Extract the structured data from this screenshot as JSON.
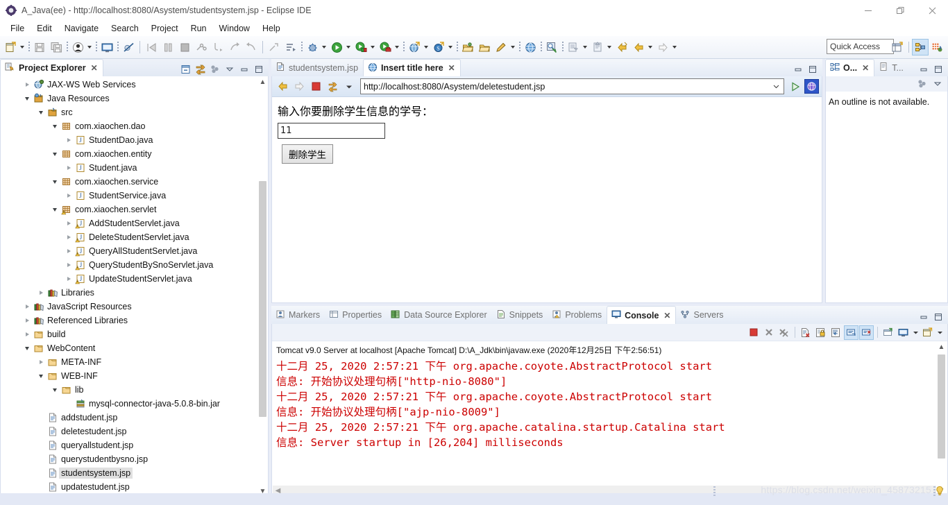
{
  "window": {
    "title": "A_Java(ee) - http://localhost:8080/Asystem/studentsystem.jsp - Eclipse IDE",
    "app_icon": "eclipse-icon",
    "minimize": "minimize-icon",
    "maximize": "restore-icon",
    "close": "close-icon"
  },
  "menubar": {
    "items": [
      {
        "label": "File"
      },
      {
        "label": "Edit"
      },
      {
        "label": "Navigate"
      },
      {
        "label": "Search"
      },
      {
        "label": "Project"
      },
      {
        "label": "Run"
      },
      {
        "label": "Window"
      },
      {
        "label": "Help"
      }
    ]
  },
  "toolbar": {
    "quick_access_placeholder": "Quick Access",
    "items": [
      {
        "icon": "new-wizard-icon",
        "dropdown": true
      },
      {
        "sep": "dots"
      },
      {
        "icon": "save-icon",
        "dropdown": false
      },
      {
        "icon": "save-all-icon",
        "dropdown": false
      },
      {
        "sep": "dots"
      },
      {
        "icon": "user-icon",
        "dropdown": true
      },
      {
        "sep": "dots"
      },
      {
        "icon": "open-console-icon",
        "dropdown": false
      },
      {
        "sep": "dots"
      },
      {
        "icon": "skip-breakpoints-icon",
        "dropdown": false
      },
      {
        "sep": "line"
      },
      {
        "icon": "resume-icon",
        "dropdown": false
      },
      {
        "icon": "suspend-icon",
        "dropdown": false
      },
      {
        "icon": "terminate-icon",
        "dropdown": false
      },
      {
        "icon": "disconnect-icon",
        "dropdown": false
      },
      {
        "icon": "step-into-icon",
        "dropdown": false
      },
      {
        "icon": "step-over-icon",
        "dropdown": false
      },
      {
        "icon": "step-return-icon",
        "dropdown": false
      },
      {
        "sep": "line"
      },
      {
        "icon": "next-annotation-icon",
        "dropdown": false
      },
      {
        "icon": "previous-annotation-icon",
        "dropdown": false
      },
      {
        "sep": "dots"
      },
      {
        "icon": "debug-icon",
        "dropdown": true
      },
      {
        "icon": "run-icon",
        "dropdown": true
      },
      {
        "icon": "run-as-server-icon",
        "dropdown": true
      },
      {
        "icon": "profile-icon",
        "dropdown": true
      },
      {
        "sep": "dots"
      },
      {
        "icon": "new-web-project-icon",
        "dropdown": true
      },
      {
        "icon": "new-server-icon",
        "dropdown": true
      },
      {
        "sep": "dots"
      },
      {
        "icon": "open-type-icon",
        "dropdown": false
      },
      {
        "icon": "open-task-icon",
        "dropdown": false
      },
      {
        "icon": "pencil-icon",
        "dropdown": true
      },
      {
        "sep": "dots"
      },
      {
        "icon": "web-browser-icon",
        "dropdown": false
      },
      {
        "sep": "dots"
      },
      {
        "icon": "search-icon",
        "dropdown": false
      },
      {
        "sep": "dots"
      },
      {
        "icon": "last-edit-location-icon",
        "dropdown": true
      },
      {
        "icon": "previous-edit-icon",
        "dropdown": true
      },
      {
        "icon": "back-history-icon",
        "dropdown": false
      },
      {
        "icon": "back-icon",
        "dropdown": true
      },
      {
        "icon": "forward-icon",
        "dropdown": true
      }
    ],
    "perspective": {
      "open_perspective_icon": "open-perspective-icon",
      "perspectives": [
        {
          "icon": "java-ee-perspective-icon",
          "selected": true
        },
        {
          "icon": "java-perspective-icon",
          "selected": false
        }
      ]
    }
  },
  "project_explorer": {
    "tab_label": "Project Explorer",
    "tab_icon": "project-explorer-icon",
    "close_icon": "close-icon",
    "toolbar": [
      {
        "icon": "collapse-all-icon"
      },
      {
        "icon": "link-with-editor-icon"
      },
      {
        "icon": "view-menu-icon"
      },
      {
        "icon": "view-dropdown-icon"
      },
      {
        "icon": "minimize-icon"
      },
      {
        "icon": "maximize-icon"
      }
    ],
    "tree": [
      {
        "indent": 1,
        "twisty": "right",
        "icon": "web-services-icon",
        "label": "JAX-WS Web Services",
        "selected": false
      },
      {
        "indent": 1,
        "twisty": "down",
        "icon": "java-resources-icon",
        "label": "Java Resources",
        "selected": false
      },
      {
        "indent": 2,
        "twisty": "down",
        "icon": "source-folder-icon",
        "label": "src",
        "selected": false
      },
      {
        "indent": 3,
        "twisty": "down",
        "icon": "package-icon",
        "label": "com.xiaochen.dao",
        "selected": false
      },
      {
        "indent": 4,
        "twisty": "right",
        "icon": "java-file-icon",
        "label": "StudentDao.java",
        "selected": false
      },
      {
        "indent": 3,
        "twisty": "down",
        "icon": "package-icon",
        "label": "com.xiaochen.entity",
        "selected": false
      },
      {
        "indent": 4,
        "twisty": "right",
        "icon": "java-file-icon",
        "label": "Student.java",
        "selected": false
      },
      {
        "indent": 3,
        "twisty": "down",
        "icon": "package-icon",
        "label": "com.xiaochen.service",
        "selected": false
      },
      {
        "indent": 4,
        "twisty": "right",
        "icon": "java-file-icon",
        "label": "StudentService.java",
        "selected": false
      },
      {
        "indent": 3,
        "twisty": "down",
        "icon": "package-warning-icon",
        "label": "com.xiaochen.servlet",
        "selected": false
      },
      {
        "indent": 4,
        "twisty": "right",
        "icon": "java-file-warning-icon",
        "label": "AddStudentServlet.java",
        "selected": false
      },
      {
        "indent": 4,
        "twisty": "right",
        "icon": "java-file-warning-icon",
        "label": "DeleteStudentServlet.java",
        "selected": false
      },
      {
        "indent": 4,
        "twisty": "right",
        "icon": "java-file-warning-icon",
        "label": "QueryAllStudentServlet.java",
        "selected": false
      },
      {
        "indent": 4,
        "twisty": "right",
        "icon": "java-file-warning-icon",
        "label": "QueryStudentBySnoServlet.java",
        "selected": false
      },
      {
        "indent": 4,
        "twisty": "right",
        "icon": "java-file-warning-icon",
        "label": "UpdateStudentServlet.java",
        "selected": false
      },
      {
        "indent": 2,
        "twisty": "right",
        "icon": "library-icon",
        "label": "Libraries",
        "selected": false
      },
      {
        "indent": 1,
        "twisty": "right",
        "icon": "library-icon",
        "label": "JavaScript Resources",
        "selected": false
      },
      {
        "indent": 1,
        "twisty": "right",
        "icon": "library-icon",
        "label": "Referenced Libraries",
        "selected": false
      },
      {
        "indent": 1,
        "twisty": "right",
        "icon": "folder-icon",
        "label": "build",
        "selected": false
      },
      {
        "indent": 1,
        "twisty": "down",
        "icon": "folder-icon",
        "label": "WebContent",
        "selected": false
      },
      {
        "indent": 2,
        "twisty": "right",
        "icon": "folder-icon",
        "label": "META-INF",
        "selected": false
      },
      {
        "indent": 2,
        "twisty": "down",
        "icon": "folder-icon",
        "label": "WEB-INF",
        "selected": false
      },
      {
        "indent": 3,
        "twisty": "down",
        "icon": "folder-icon",
        "label": "lib",
        "selected": false
      },
      {
        "indent": 4,
        "twisty": "none",
        "icon": "jar-icon",
        "label": "mysql-connector-java-5.0.8-bin.jar",
        "selected": false
      },
      {
        "indent": 2,
        "twisty": "none",
        "icon": "jsp-file-icon",
        "label": "addstudent.jsp",
        "selected": false
      },
      {
        "indent": 2,
        "twisty": "none",
        "icon": "jsp-file-icon",
        "label": "deletestudent.jsp",
        "selected": false
      },
      {
        "indent": 2,
        "twisty": "none",
        "icon": "jsp-file-icon",
        "label": "queryallstudent.jsp",
        "selected": false
      },
      {
        "indent": 2,
        "twisty": "none",
        "icon": "jsp-file-icon",
        "label": "querystudentbysno.jsp",
        "selected": false
      },
      {
        "indent": 2,
        "twisty": "none",
        "icon": "jsp-file-icon",
        "label": "studentsystem.jsp",
        "selected": true
      },
      {
        "indent": 2,
        "twisty": "none",
        "icon": "jsp-file-icon",
        "label": "updatestudent.jsp",
        "selected": false
      }
    ]
  },
  "editor": {
    "tabs": [
      {
        "label": "studentsystem.jsp",
        "icon": "jsp-file-icon",
        "active": false,
        "close": false
      },
      {
        "label": "Insert title here",
        "icon": "web-browser-icon",
        "active": true,
        "close": true
      }
    ],
    "close_icon": "close-icon",
    "part_buttons": [
      {
        "icon": "minimize-icon"
      },
      {
        "icon": "maximize-icon"
      }
    ],
    "browser": {
      "back_icon": "back-arrow-icon",
      "forward_icon": "forward-arrow-icon",
      "stop_icon": "stop-icon",
      "refresh_icon": "refresh-icon",
      "refresh_dropdown_icon": "chevron-down-icon",
      "url": "http://localhost:8080/Asystem/deletestudent.jsp",
      "url_dropdown_icon": "chevron-down-icon",
      "go_icon": "go-icon",
      "open_external_icon": "open-in-external-browser-icon"
    },
    "page": {
      "label": "输入你要删除学生信息的学号：",
      "input_value": "11",
      "button_label": "删除学生"
    }
  },
  "outline": {
    "tabs": [
      {
        "label": "O...",
        "icon": "outline-icon",
        "active": true,
        "close": true
      },
      {
        "label": "T...",
        "icon": "task-list-icon",
        "active": false,
        "close": false
      }
    ],
    "close_icon": "close-icon",
    "part_buttons": [
      {
        "icon": "minimize-icon"
      },
      {
        "icon": "maximize-icon"
      }
    ],
    "view_toolbar": [
      {
        "icon": "view-menu-icon"
      },
      {
        "icon": "view-dropdown-icon"
      }
    ],
    "message": "An outline is not available."
  },
  "console_panel": {
    "tabs": [
      {
        "label": "Markers",
        "icon": "markers-icon",
        "active": false,
        "close": false
      },
      {
        "label": "Properties",
        "icon": "properties-icon",
        "active": false,
        "close": false
      },
      {
        "label": "Data Source Explorer",
        "icon": "data-source-explorer-icon",
        "active": false,
        "close": false
      },
      {
        "label": "Snippets",
        "icon": "snippets-icon",
        "active": false,
        "close": false
      },
      {
        "label": "Problems",
        "icon": "problems-icon",
        "active": false,
        "close": false
      },
      {
        "label": "Console",
        "icon": "console-icon",
        "active": true,
        "close": true
      },
      {
        "label": "Servers",
        "icon": "servers-icon",
        "active": false,
        "close": false
      }
    ],
    "close_icon": "close-icon",
    "part_buttons": [
      {
        "icon": "minimize-icon"
      },
      {
        "icon": "maximize-icon"
      }
    ],
    "toolbar": [
      {
        "icon": "terminate-icon",
        "selected": false
      },
      {
        "icon": "remove-launch-icon",
        "selected": false
      },
      {
        "icon": "remove-all-terminated-icon",
        "selected": false
      },
      {
        "sep": true
      },
      {
        "icon": "clear-console-icon",
        "selected": false
      },
      {
        "icon": "scroll-lock-icon",
        "selected": false
      },
      {
        "icon": "word-wrap-icon",
        "selected": false
      },
      {
        "icon": "show-console-on-output-icon",
        "selected": true
      },
      {
        "icon": "show-console-on-error-icon",
        "selected": true
      },
      {
        "sep": true
      },
      {
        "icon": "pin-console-icon",
        "selected": false
      },
      {
        "icon": "display-selected-console-icon",
        "selected": false,
        "dropdown": true
      },
      {
        "icon": "open-console-icon",
        "selected": false,
        "dropdown": true
      }
    ],
    "header": "Tomcat v9.0 Server at localhost [Apache Tomcat] D:\\A_Jdk\\bin\\javaw.exe (2020年12月25日 下午2:56:51)",
    "lines": [
      "十二月 25, 2020 2:57:21 下午 org.apache.coyote.AbstractProtocol start",
      "信息: 开始协议处理句柄[\"http-nio-8080\"]",
      "十二月 25, 2020 2:57:21 下午 org.apache.coyote.AbstractProtocol start",
      "信息: 开始协议处理句柄[\"ajp-nio-8009\"]",
      "十二月 25, 2020 2:57:21 下午 org.apache.catalina.startup.Catalina start",
      "信息: Server startup in [26,204] milliseconds"
    ],
    "text_color": "#cc0000",
    "scroll_left_icon": "scroll-left-icon"
  },
  "status_bar": {
    "watermark": "https://blog.csdn.net/weixin_45873215",
    "tip_icon": "tip-lightbulb-icon"
  }
}
